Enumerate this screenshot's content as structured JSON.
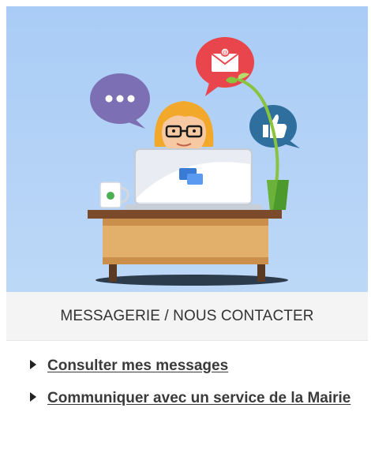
{
  "card": {
    "illustration_label": "",
    "title": "MESSAGERIE / NOUS CONTACTER"
  },
  "links": [
    {
      "label": "Consulter mes messages"
    },
    {
      "label": "Communiquer avec un service de la Mairie"
    }
  ],
  "colors": {
    "sky": "#a9ccf6",
    "title_bar": "#f4f4f4",
    "desk_top": "#7a4a2b",
    "desk_body": "#e2b06a",
    "laptop": "#e9edf3",
    "chat_bubble": "#3a7bd5",
    "hair": "#f2a92b",
    "bubble_purple": "#7d6fb4",
    "bubble_red": "#e8464c",
    "bubble_blue": "#2f6f9e",
    "plant_green": "#8ac43f"
  }
}
